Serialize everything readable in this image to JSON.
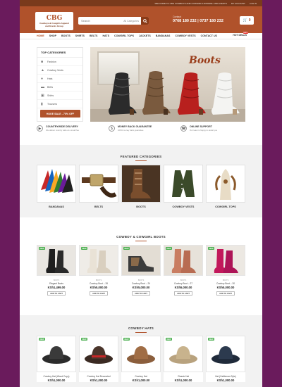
{
  "topbar": {
    "welcome": "WELCOME TO CBG COWBOYS AND COWGIRLS APPAREL AND EVENTS",
    "account": "MY ACCOUNT",
    "login": "LOG IN"
  },
  "header": {
    "logo_mark": "CBG",
    "logo_sub_1": "Cowboys & Cowgirls Apparel",
    "logo_sub_2": "and Events Group",
    "search_placeholder": "Search",
    "search_category": "All Categories",
    "contact_label": "Contact",
    "phone": "0768 180 232 | 0737 180 232",
    "cart_count": "0"
  },
  "nav": {
    "items": [
      "HOME",
      "SHOP",
      "BOOTS",
      "SHIRTS",
      "BELTS",
      "HATS",
      "COWGIRL TOPS",
      "JACKETS",
      "BANDANAS",
      "COWBOY VESTS",
      "CONTACT US"
    ],
    "deal_label": "HOT DEALS",
    "deal_badge": "HOT"
  },
  "categories": {
    "title": "TOP CATEGORIES",
    "items": [
      "Fashion",
      "Cowboy Vests",
      "Hats",
      "Belts",
      "Shirts",
      "Trousers"
    ],
    "sale_button": "HUGE SALE - 70% OFF"
  },
  "hero": {
    "title": "Boots"
  },
  "features": [
    {
      "title": "COUNTRYWIDE DELIVERY",
      "sub": "We deliver country wide at a small fee"
    },
    {
      "title": "MONEY BACK GUARANTEE",
      "sub": "100% money back guarantee"
    },
    {
      "title": "ONLINE SUPPORT",
      "sub": "Our team is happy to assist you"
    }
  ],
  "featured": {
    "title": "FEATURED CATEGORIES",
    "items": [
      "BANDANAS",
      "BELTS",
      "BOOTS",
      "COWBOY VESTS",
      "COWGIRL TOPS"
    ]
  },
  "boots_section": {
    "title": "COWBOY & COWGIRL BOOTS",
    "products": [
      {
        "badge": "NEW",
        "cat": "BOOTS",
        "name": "Elegant Boots",
        "price": "KSh1,499.00",
        "btn": "ADD TO CART"
      },
      {
        "badge": "NEW",
        "cat": "BOOTS",
        "name": "Cowboy Boot – 26",
        "price": "KSh5,000.00",
        "btn": "ADD TO CART"
      },
      {
        "badge": "NEW",
        "cat": "BOOTS",
        "name": "Cowboy Boot – 24",
        "price": "KSh5,000.00",
        "btn": "ADD TO CART"
      },
      {
        "badge": "NEW",
        "cat": "BOOTS",
        "name": "Cowboy Boot – 27",
        "price": "KSh5,000.00",
        "btn": "ADD TO CART"
      },
      {
        "badge": "NEW",
        "cat": "BOOTS",
        "name": "Cowboy Boot – 30",
        "price": "KSh5,000.00",
        "btn": "ADD TO CART"
      }
    ]
  },
  "hats_section": {
    "title": "COWBOY HATS",
    "products": [
      {
        "badge": "NEW",
        "name": "Cowboy Hat (Wood Copy)",
        "price": "KSh1,000.00"
      },
      {
        "badge": "NEW",
        "name": "Cowboy Hat Decorated",
        "price": "KSh1,000.00"
      },
      {
        "badge": "NEW",
        "name": "Cowboy Hat",
        "price": "KSh1,000.00"
      },
      {
        "badge": "NEW",
        "name": "Classic Hat",
        "price": "KSh1,000.00"
      },
      {
        "badge": "NEW",
        "name": "Hat (Cattleman Syle)",
        "price": "KSh1,000.00"
      }
    ]
  }
}
